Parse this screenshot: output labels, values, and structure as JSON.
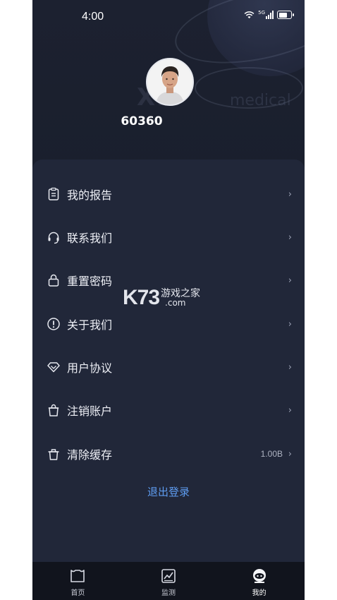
{
  "status_bar": {
    "time": "4:00",
    "network": "5G"
  },
  "profile": {
    "username": "60360",
    "watermark_logo": "XK",
    "watermark_text": "medical"
  },
  "menu": [
    {
      "label": "我的报告",
      "icon": "clipboard-icon",
      "value": ""
    },
    {
      "label": "联系我们",
      "icon": "headset-icon",
      "value": ""
    },
    {
      "label": "重置密码",
      "icon": "lock-icon",
      "value": ""
    },
    {
      "label": "关于我们",
      "icon": "info-icon",
      "value": ""
    },
    {
      "label": "用户协议",
      "icon": "diamond-icon",
      "value": ""
    },
    {
      "label": "注销账户",
      "icon": "bag-icon",
      "value": ""
    },
    {
      "label": "清除缓存",
      "icon": "trash-icon",
      "value": "1.00B"
    }
  ],
  "chevron": "›",
  "logout_label": "退出登录",
  "site_watermark": {
    "brand": "K73",
    "name": "游戏之家",
    "domain": ".com"
  },
  "tabs": [
    {
      "label": "首页",
      "icon": "home-icon"
    },
    {
      "label": "监测",
      "icon": "chart-icon"
    },
    {
      "label": "我的",
      "icon": "profile-icon"
    }
  ],
  "colors": {
    "background": "#1a1f2d",
    "card": "#212739",
    "accent": "#5e9cf0",
    "tabbar": "#11141d"
  }
}
